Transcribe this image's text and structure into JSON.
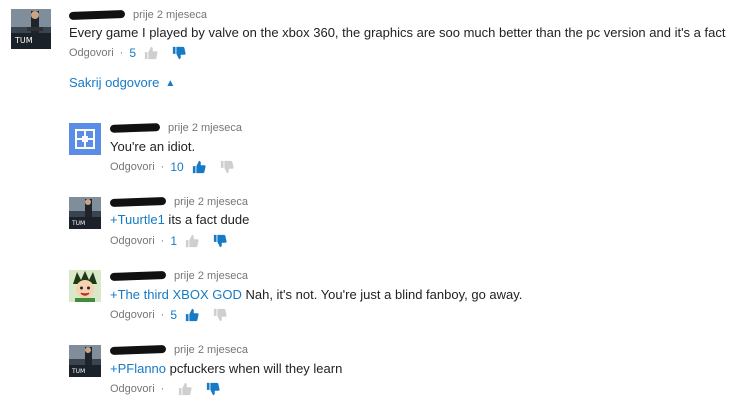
{
  "top_comment": {
    "time": "prije 2 mjeseca",
    "text": "Every game I played by valve on the xbox 360, the graphics are soo much better than the pc version and it's a fact",
    "reply_label": "Odgovori",
    "like_count": "5",
    "avatar_icon": "game-poster-avatar",
    "avatar_caption": "TUM"
  },
  "hide_replies": {
    "label": "Sakrij odgovore",
    "icon": "chevron-up-icon"
  },
  "replies": [
    {
      "time": "prije 2 mjeseca",
      "mention": "",
      "text": "You're an idiot.",
      "reply_label": "Odgovori",
      "like_count": "10",
      "liked": "up",
      "avatar_icon": "blue-default-avatar"
    },
    {
      "time": "prije 2 mjeseca",
      "mention": "+Tuurtle1",
      "text": " its a fact dude",
      "reply_label": "Odgovori",
      "like_count": "1",
      "liked": "down",
      "avatar_icon": "game-poster-avatar",
      "avatar_caption": "TUM"
    },
    {
      "time": "prije 2 mjeseca",
      "mention": "+The third XBOX GOD",
      "text": " Nah, it's not. You're just a blind fanboy, go away.",
      "reply_label": "Odgovori",
      "like_count": "5",
      "liked": "up",
      "avatar_icon": "anime-character-avatar"
    },
    {
      "time": "prije 2 mjeseca",
      "mention": "+PFlanno",
      "text": " pcfuckers when will they learn",
      "reply_label": "Odgovori",
      "like_count": "",
      "liked": "down",
      "avatar_icon": "game-poster-avatar",
      "avatar_caption": "TUM"
    }
  ],
  "colors": {
    "link": "#167ac6",
    "meta": "#767676",
    "text": "#222222"
  }
}
